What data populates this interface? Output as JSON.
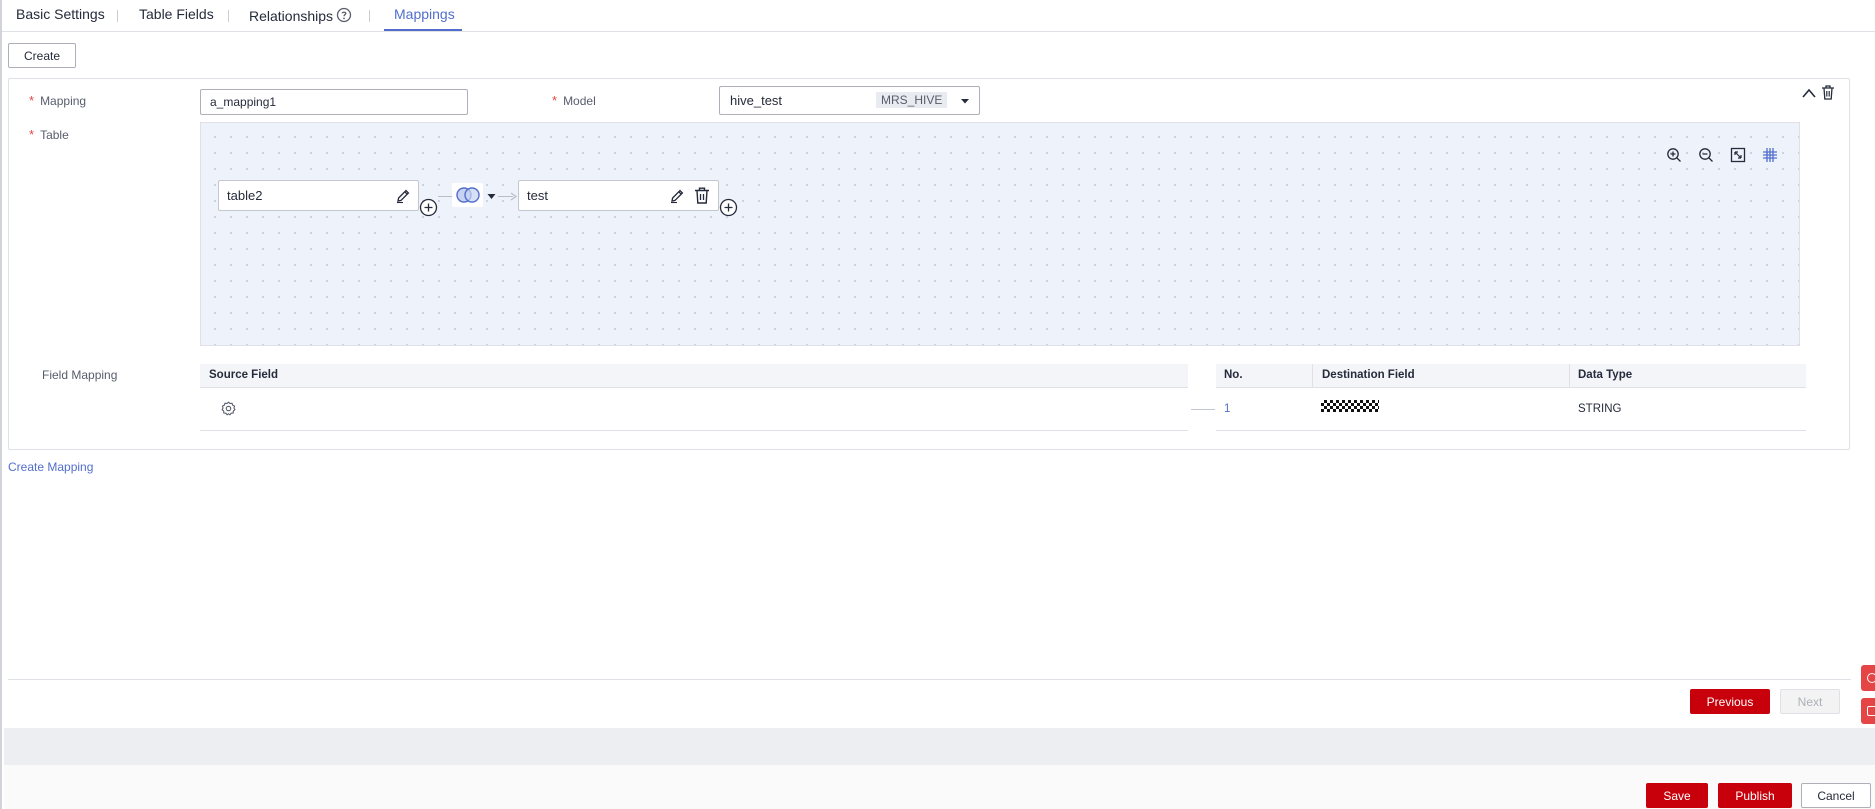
{
  "tabs": [
    {
      "label": "Basic Settings"
    },
    {
      "label": "Table Fields"
    },
    {
      "label": "Relationships"
    },
    {
      "label": "Mappings"
    }
  ],
  "toolbar": {
    "create_label": "Create"
  },
  "mapping_card": {
    "mapping_label": "Mapping",
    "mapping_value": "a_mapping1",
    "model_label": "Model",
    "model_value": "hive_test",
    "model_tag": "MRS_HIVE",
    "table_label": "Table",
    "nodes": {
      "source": "table2",
      "destination": "test"
    },
    "field_mapping_label": "Field Mapping",
    "source_table": {
      "header": "Source Field"
    },
    "destination_table": {
      "headers": [
        "No.",
        "Destination Field",
        "Data Type"
      ],
      "rows": [
        {
          "no": "1",
          "data_type": "STRING"
        }
      ]
    }
  },
  "create_mapping_link": "Create Mapping",
  "wizard": {
    "previous_label": "Previous",
    "next_label": "Next"
  },
  "footer": {
    "save_label": "Save",
    "publish_label": "Publish",
    "cancel_label": "Cancel"
  },
  "colors": {
    "accent": "#526ecc",
    "primary": "#c7000b",
    "required": "#e54545"
  },
  "icons": [
    "help-icon",
    "collapse-icon",
    "delete-icon",
    "zoom-in-icon",
    "zoom-out-icon",
    "fit-screen-icon",
    "grid-icon",
    "edit-icon",
    "add-icon",
    "join-icon",
    "settings-icon"
  ]
}
